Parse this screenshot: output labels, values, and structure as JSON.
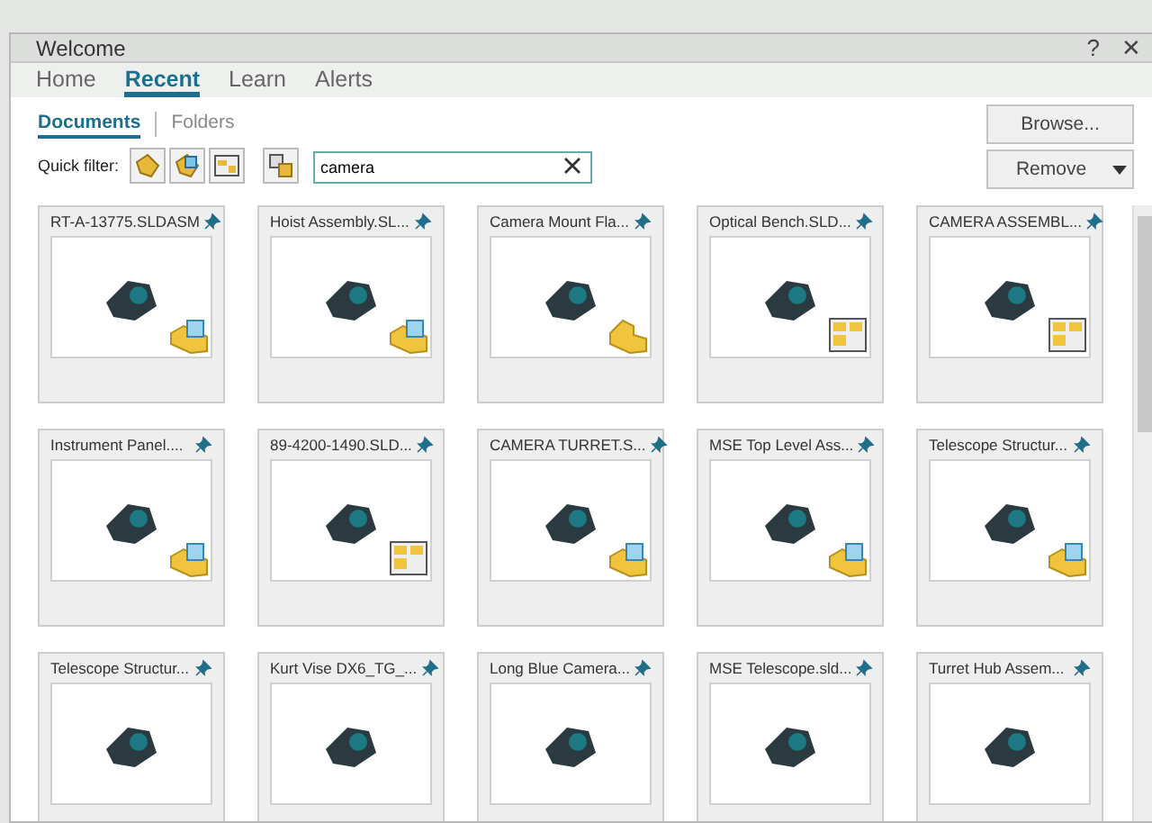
{
  "window": {
    "title": "Welcome",
    "controls": [
      "?",
      "✕"
    ]
  },
  "tabs": [
    {
      "label": "Home",
      "selected": false
    },
    {
      "label": "Recent",
      "selected": true
    },
    {
      "label": "Learn",
      "selected": false
    },
    {
      "label": "Alerts",
      "selected": false
    }
  ],
  "subtabs": [
    {
      "label": "Documents",
      "selected": true
    },
    {
      "label": "Folders",
      "selected": false
    }
  ],
  "quick_filter": {
    "label": "Quick filter:",
    "buttons": [
      {
        "kind": "part"
      },
      {
        "kind": "assembly"
      },
      {
        "kind": "drawing"
      },
      {
        "kind": "other"
      }
    ],
    "search": {
      "value": "camera"
    }
  },
  "actions": {
    "browse": "Browse...",
    "remove": "Remove"
  },
  "documents": [
    {
      "name": "RT-A-13775.SLDASM",
      "kind": "assembly"
    },
    {
      "name": "Hoist Assembly.SL...",
      "kind": "assembly"
    },
    {
      "name": "Camera Mount Fla...",
      "kind": "part"
    },
    {
      "name": "Optical Bench.SLD...",
      "kind": "drawing"
    },
    {
      "name": "CAMERA ASSEMBL...",
      "kind": "drawing"
    },
    {
      "name": "Instrument Panel....",
      "kind": "assembly"
    },
    {
      "name": "89-4200-1490.SLD...",
      "kind": "drawing"
    },
    {
      "name": "CAMERA TURRET.S...",
      "kind": "assembly"
    },
    {
      "name": "MSE Top Level Ass...",
      "kind": "assembly"
    },
    {
      "name": "Telescope Structur...",
      "kind": "assembly"
    },
    {
      "name": "Telescope Structur...",
      "kind": "unknown"
    },
    {
      "name": "Kurt Vise DX6_TG_...",
      "kind": "unknown"
    },
    {
      "name": "Long Blue Camera...",
      "kind": "unknown"
    },
    {
      "name": "MSE Telescope.sld...",
      "kind": "unknown"
    },
    {
      "name": "Turret Hub Assem...",
      "kind": "unknown"
    }
  ]
}
